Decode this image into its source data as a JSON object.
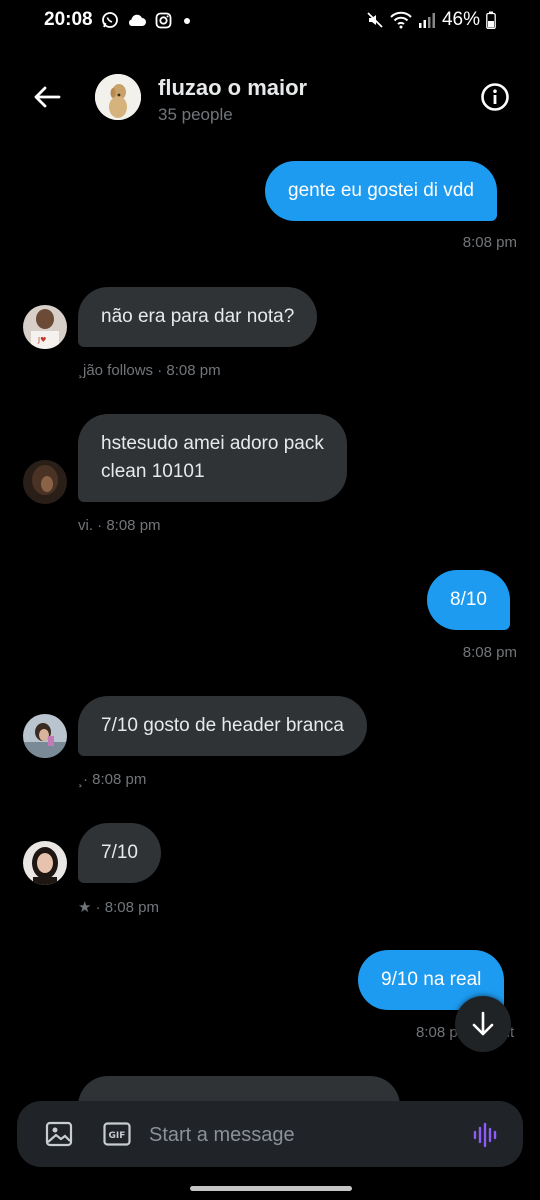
{
  "status_bar": {
    "time": "20:08",
    "battery": "46%",
    "left_icons": [
      "whatsapp-icon",
      "cloud-icon",
      "instagram-icon",
      "dot-icon"
    ],
    "right_icons": [
      "mute-icon",
      "wifi-icon",
      "signal-icon",
      "battery-icon"
    ]
  },
  "header": {
    "title": "fluzao o maior",
    "subtitle": "35 people"
  },
  "messages": [
    {
      "direction": "out",
      "text": "gente eu gostei di vdd",
      "meta": "8:08 pm"
    },
    {
      "direction": "in",
      "text": "não era para dar nota?",
      "meta": "¸jão follows · 8:08 pm"
    },
    {
      "direction": "in",
      "text_line1": "hstesudo amei adoro pack",
      "text_line2": "clean 10101",
      "meta": "vi. · 8:08 pm"
    },
    {
      "direction": "out",
      "text": "8/10",
      "meta": "8:08 pm"
    },
    {
      "direction": "in",
      "text": "7/10 gosto de header branca",
      "meta": "¸· 8:08 pm"
    },
    {
      "direction": "in",
      "text": "7/10",
      "meta": "★ · 8:08 pm"
    },
    {
      "direction": "out",
      "text": "9/10 na real",
      "meta_time": "8:08 p",
      "meta_tail": "nt"
    }
  ],
  "composer": {
    "placeholder": "Start a message",
    "accent": "#8b5cf6"
  },
  "colors": {
    "accent": "#1d9bf0",
    "incoming_bubble": "#2f3336",
    "muted_text": "#71767b",
    "background": "#000000"
  }
}
